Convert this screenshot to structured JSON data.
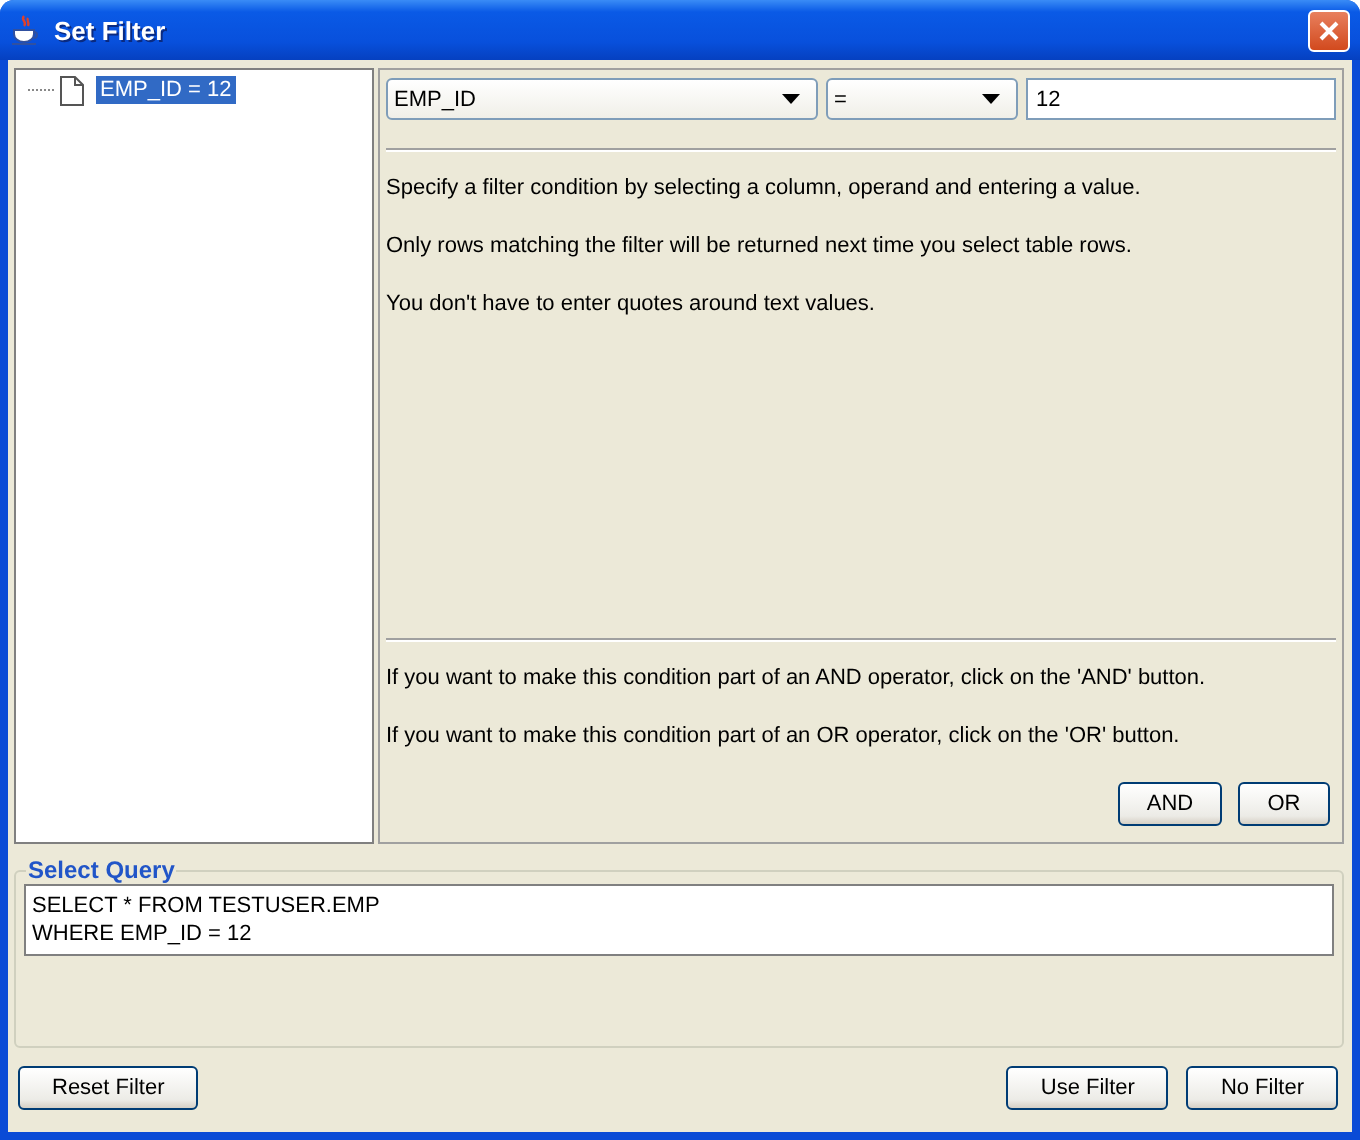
{
  "window": {
    "title": "Set Filter"
  },
  "tree": {
    "items": [
      {
        "label": "EMP_ID = 12",
        "selected": true
      }
    ]
  },
  "condition": {
    "column": "EMP_ID",
    "operator": "=",
    "value": "12"
  },
  "help": [
    "Specify a filter condition by selecting a column, operand and entering a value.",
    "Only rows matching the filter will be returned next time you select table rows.",
    "You don't have to enter quotes around text values."
  ],
  "combine_help": [
    "If you want to make this condition part of an AND operator, click on the 'AND' button.",
    "If you want to make this condition part of an OR operator, click on the 'OR' button."
  ],
  "combine_buttons": [
    "AND",
    "OR"
  ],
  "query": {
    "title": "Select Query",
    "lines": [
      "SELECT * FROM TESTUSER.EMP",
      "WHERE EMP_ID = 12"
    ]
  },
  "buttons_left": [
    "Reset Filter"
  ],
  "buttons_right": [
    "Use Filter",
    "No Filter"
  ]
}
